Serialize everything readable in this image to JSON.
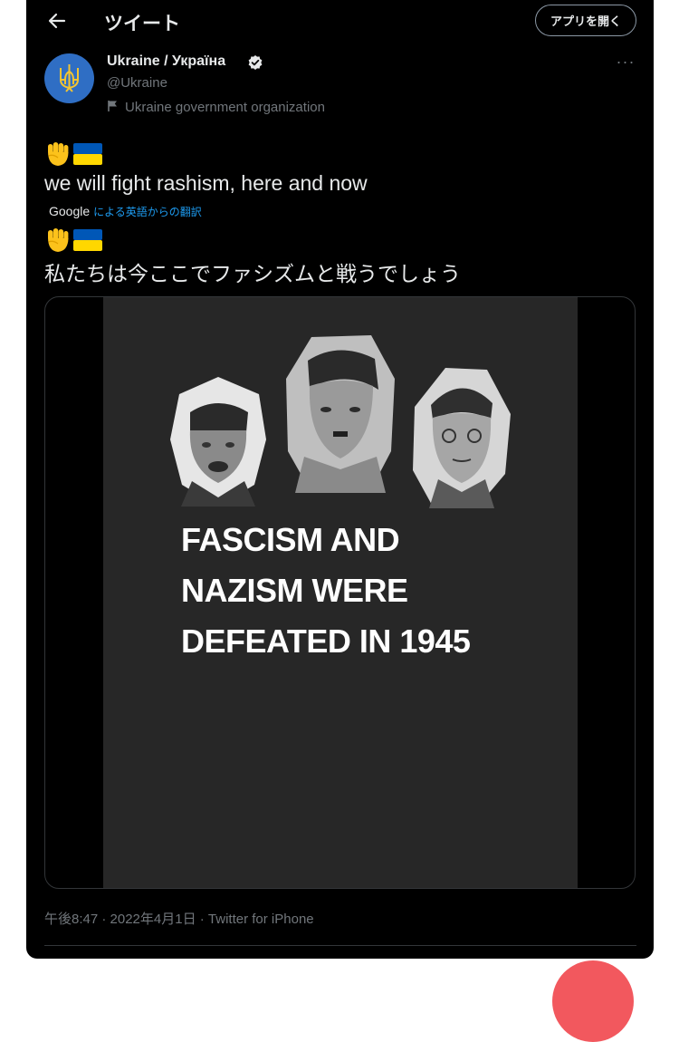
{
  "header": {
    "back_icon": "arrow-left-icon",
    "title": "ツイート",
    "open_app_label": "アプリを開く"
  },
  "author": {
    "name": "Ukraine / Україна",
    "handle": "@Ukraine",
    "org_label": "Ukraine government organization",
    "verified": true
  },
  "tweet": {
    "text_en": "we will fight rashism, here and now",
    "translated_by_logo": "Google",
    "translated_by_text": "による英語からの翻訳",
    "text_ja": "私たちは今ここでファシズムと戦うでしょう"
  },
  "media": {
    "caption_lines": [
      "FASCISM AND",
      "NAZISM WERE",
      "DEFEATED IN 1945"
    ]
  },
  "meta": {
    "timestamp": "午後8:47 · 2022年4月1日 · Twitter for iPhone"
  },
  "colors": {
    "background": "#000000",
    "text": "#e7e9ea",
    "secondary": "#71767b",
    "link": "#1d9bf0",
    "avatar": "#2f6ec4"
  }
}
